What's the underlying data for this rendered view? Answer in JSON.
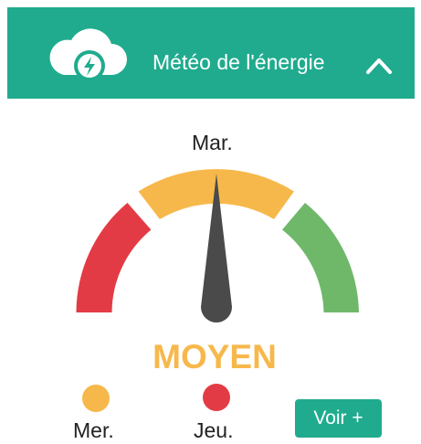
{
  "header": {
    "title": "Météo de l'énergie",
    "icon": "cloud-lightning-icon",
    "toggle_icon": "chevron-up-icon"
  },
  "gauge": {
    "current_day": "Mar.",
    "level": "MOYEN",
    "segments": [
      {
        "name": "low",
        "color": "#e33b45"
      },
      {
        "name": "medium",
        "color": "#f7b84b"
      },
      {
        "name": "high",
        "color": "#6fb86a"
      }
    ],
    "needle_color": "#4a4a4a"
  },
  "forecast": [
    {
      "day": "Mer.",
      "color": "#f7b84b"
    },
    {
      "day": "Jeu.",
      "color": "#e33b45"
    }
  ],
  "actions": {
    "more_label": "Voir +"
  },
  "colors": {
    "brand": "#20ab8e",
    "level_text": "#f7b84b"
  }
}
